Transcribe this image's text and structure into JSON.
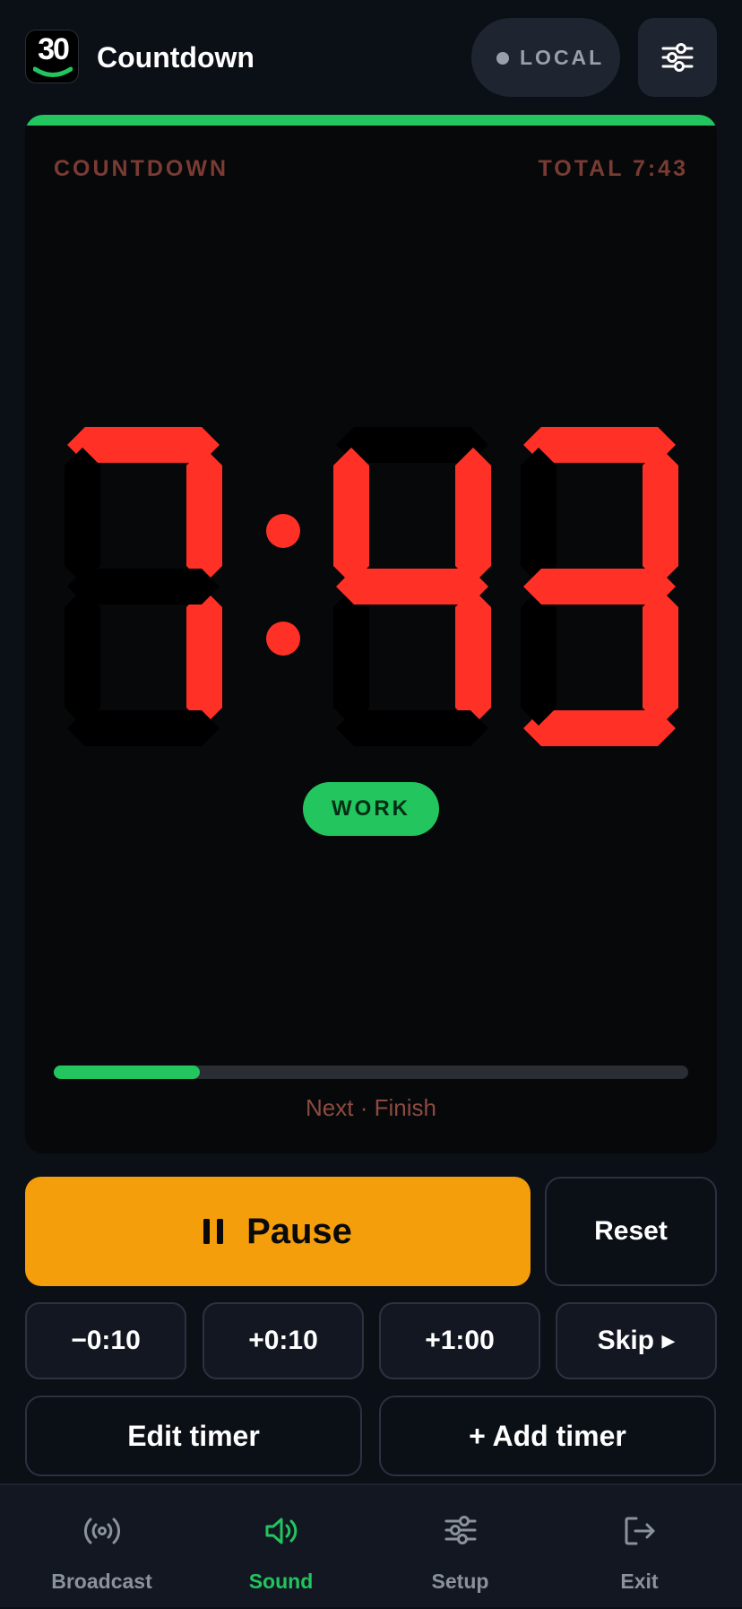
{
  "header": {
    "app_icon_text": "30",
    "title": "Countdown",
    "mode_pill": "LOCAL",
    "settings_icon": "sliders-icon"
  },
  "timer": {
    "mode_label": "COUNTDOWN",
    "total_label": "TOTAL 7:43",
    "display": "7:43",
    "phase_badge": "WORK",
    "progress_fraction": 0.23,
    "next_label": "Next · Finish"
  },
  "controls": {
    "pause_label": "Pause",
    "reset_label": "Reset",
    "adjust": [
      "−0:10",
      "+0:10",
      "+1:00",
      "Skip ▸"
    ],
    "edit_label": "Edit timer",
    "add_label": "+ Add timer"
  },
  "nav": [
    {
      "label": "Broadcast",
      "icon": "broadcast-icon",
      "active": false
    },
    {
      "label": "Sound",
      "icon": "speaker-icon",
      "active": true
    },
    {
      "label": "Setup",
      "icon": "sliders-icon",
      "active": false
    },
    {
      "label": "Exit",
      "icon": "exit-icon",
      "active": false
    }
  ],
  "colors": {
    "accent_green": "#22c55e",
    "digit_red": "#ff3126",
    "pause_orange": "#f59e0b",
    "background": "#0b0f16"
  }
}
